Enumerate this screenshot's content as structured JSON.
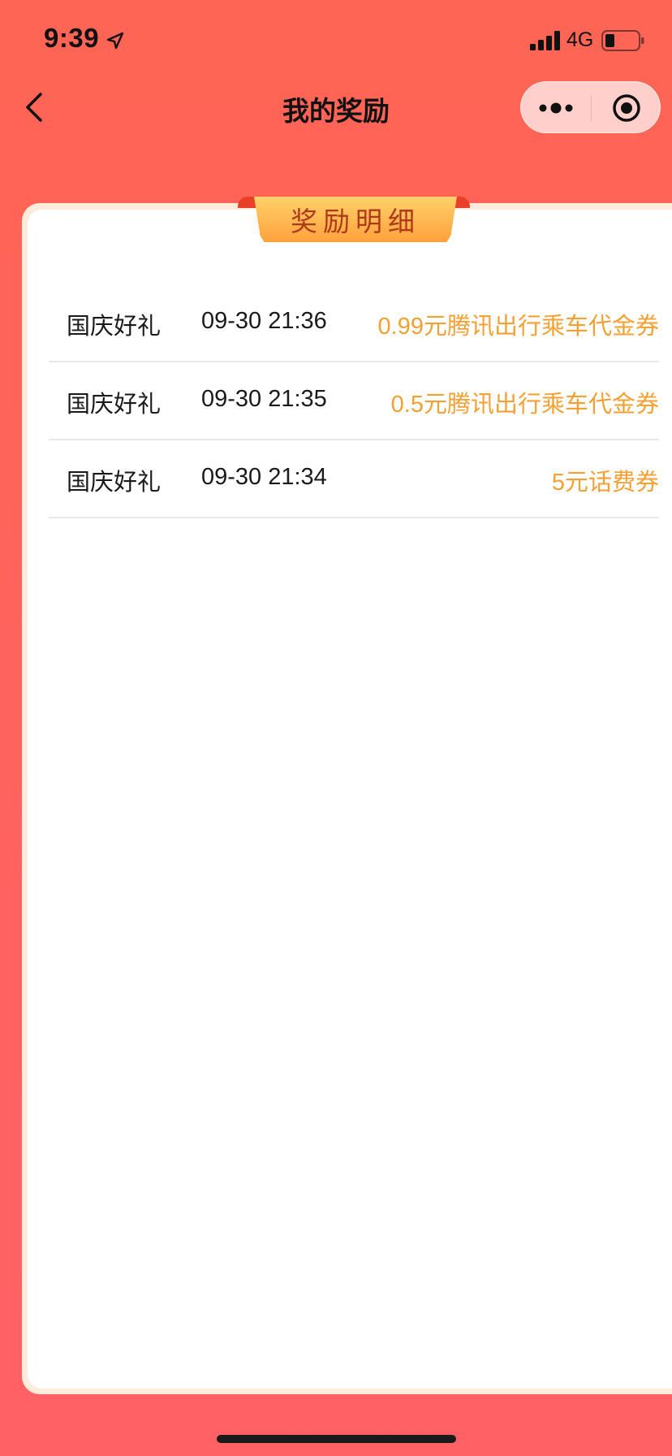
{
  "status_bar": {
    "time": "9:39",
    "network": "4G",
    "icons": [
      "location-arrow-icon",
      "signal-bars-icon",
      "battery-low-icon"
    ]
  },
  "nav": {
    "title": "我的奖励",
    "icons": [
      "chevron-left-icon",
      "more-dots-icon",
      "record-target-icon"
    ]
  },
  "ribbon": {
    "label": "奖励明细"
  },
  "rewards": [
    {
      "source": "国庆好礼",
      "time": "09-30 21:36",
      "reward": "0.99元腾讯出行乘车代金券"
    },
    {
      "source": "国庆好礼",
      "time": "09-30 21:35",
      "reward": "0.5元腾讯出行乘车代金券"
    },
    {
      "source": "国庆好礼",
      "time": "09-30 21:34",
      "reward": "5元话费券"
    }
  ],
  "colors": {
    "background": "#FF6356",
    "reward_accent": "#F5A033",
    "ribbon_text": "#B0391B",
    "capsule": "#FFCFCB"
  }
}
